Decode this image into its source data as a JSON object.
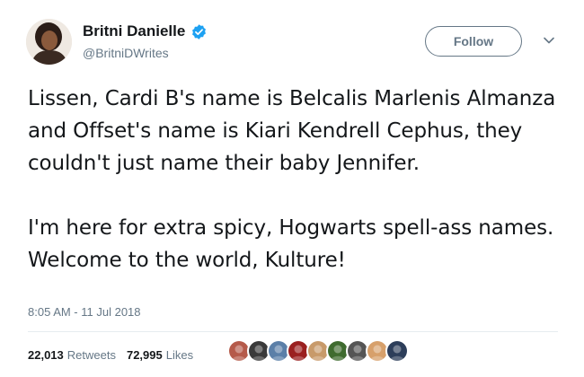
{
  "user": {
    "name": "Britni Danielle",
    "handle": "@BritniDWrites",
    "verified": true
  },
  "follow_label": "Follow",
  "tweet": {
    "paragraphs": [
      "Lissen, Cardi B's name is Belcalis Marlenis Almanza and Offset's name is Kiari Kendrell Cephus, they couldn't just name their baby Jennifer.",
      "I'm here for extra spicy, Hogwarts spell-ass names. Welcome to the world, Kulture!"
    ],
    "timestamp": "8:05 AM - 11 Jul 2018"
  },
  "stats": {
    "retweets_count": "22,013",
    "retweets_label": "Retweets",
    "likes_count": "72,995",
    "likes_label": "Likes"
  },
  "colors": {
    "verified_badge": "#1da1f2",
    "secondary_text": "#657786",
    "divider": "#e6ecf0"
  },
  "liker_avatars": [
    {
      "name": "liker-avatar-1",
      "color": "#b55a4a"
    },
    {
      "name": "liker-avatar-2",
      "color": "#3a3a3a"
    },
    {
      "name": "liker-avatar-3",
      "color": "#5b7fa8"
    },
    {
      "name": "liker-avatar-4",
      "color": "#9b2020"
    },
    {
      "name": "liker-avatar-5",
      "color": "#c89a6a"
    },
    {
      "name": "liker-avatar-6",
      "color": "#3f6b2f"
    },
    {
      "name": "liker-avatar-7",
      "color": "#555555"
    },
    {
      "name": "liker-avatar-8",
      "color": "#d7a06b"
    },
    {
      "name": "liker-avatar-9",
      "color": "#2d3e5a"
    }
  ]
}
